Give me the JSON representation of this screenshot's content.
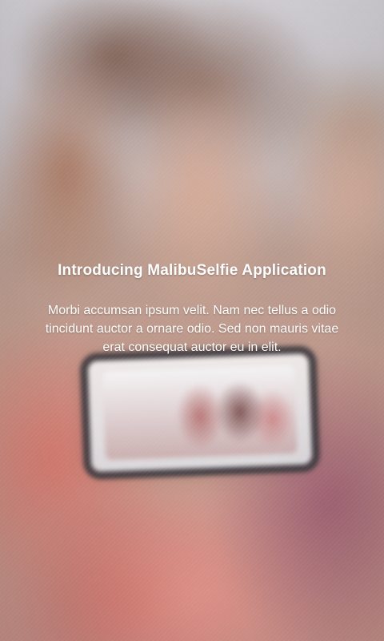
{
  "intro": {
    "title": "Introducing MalibuSelfie Application",
    "body": "Morbi accumsan ipsum velit. Nam nec tellus a odio tincidunt auctor a ornare odio. Sed non  mauris vitae erat consequat auctor eu in elit."
  }
}
